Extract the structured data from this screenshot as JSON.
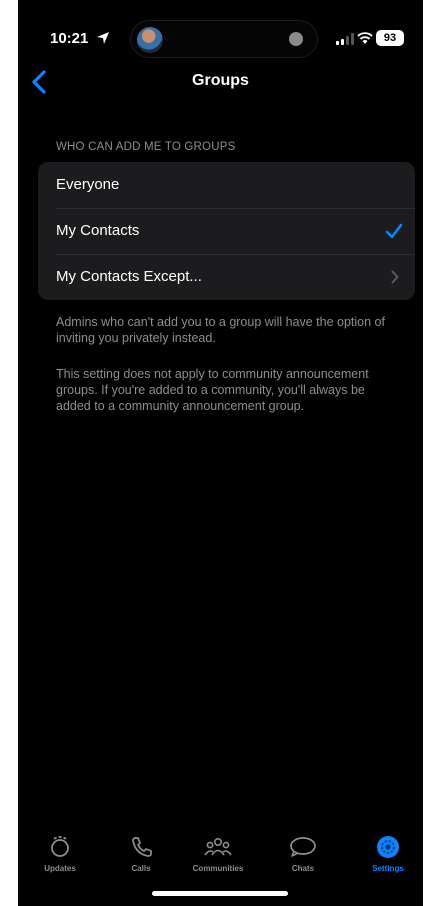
{
  "status_bar": {
    "time": "10:21",
    "battery": "93"
  },
  "nav": {
    "title": "Groups"
  },
  "section": {
    "header": "WHO CAN ADD ME TO GROUPS",
    "options": [
      {
        "label": "Everyone"
      },
      {
        "label": "My Contacts"
      },
      {
        "label": "My Contacts Except..."
      }
    ],
    "selected": "My Contacts"
  },
  "footnotes": {
    "admins": "Admins who can't add you to a group will have the option of inviting you privately instead.",
    "community": "This setting does not apply to community announcement groups. If you're added to a community, you'll always be added to a community announcement group."
  },
  "tabs": [
    {
      "label": "Updates",
      "icon": "updates-icon"
    },
    {
      "label": "Calls",
      "icon": "phone-icon"
    },
    {
      "label": "Communities",
      "icon": "communities-icon"
    },
    {
      "label": "Chats",
      "icon": "chat-bubble-icon"
    },
    {
      "label": "Settings",
      "icon": "gear-icon"
    }
  ],
  "colors": {
    "accent": "#0a84ff",
    "background": "#000000",
    "card": "#1c1c1e",
    "secondary_text": "#8d8d93"
  }
}
